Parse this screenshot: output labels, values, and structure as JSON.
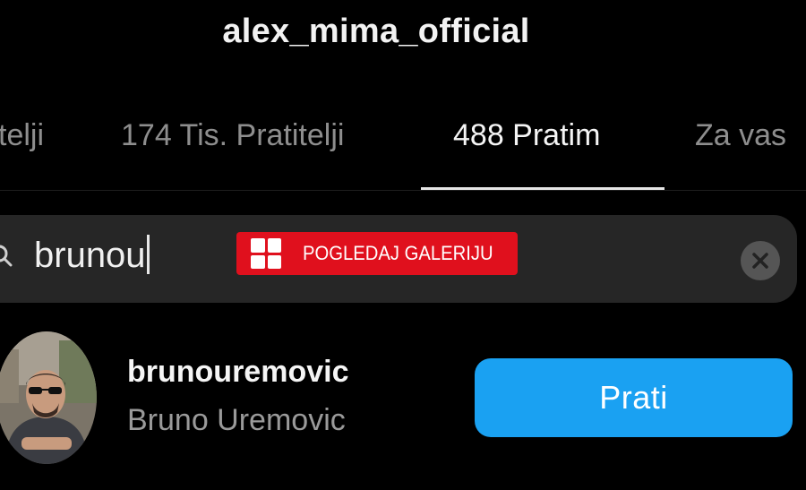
{
  "header": {
    "title": "alex_mima_official"
  },
  "tabs": [
    {
      "label": "telji"
    },
    {
      "label": "174 Tis. Pratitelji"
    },
    {
      "label": "488 Pratim"
    },
    {
      "label": "Za vas"
    }
  ],
  "search": {
    "value": "brunou"
  },
  "overlay": {
    "gallery_label": "POGLEDAJ GALERIJU"
  },
  "result": {
    "username": "brunouremovic",
    "full_name": "Bruno Uremovic",
    "follow_label": "Prati"
  },
  "icons": {
    "search": "search-icon",
    "clear": "clear-x-icon",
    "gallery": "grid-icon"
  },
  "colors": {
    "background": "#000000",
    "follow_button": "#1aa1f2",
    "gallery_button": "#e0101d",
    "search_field": "#262626"
  }
}
